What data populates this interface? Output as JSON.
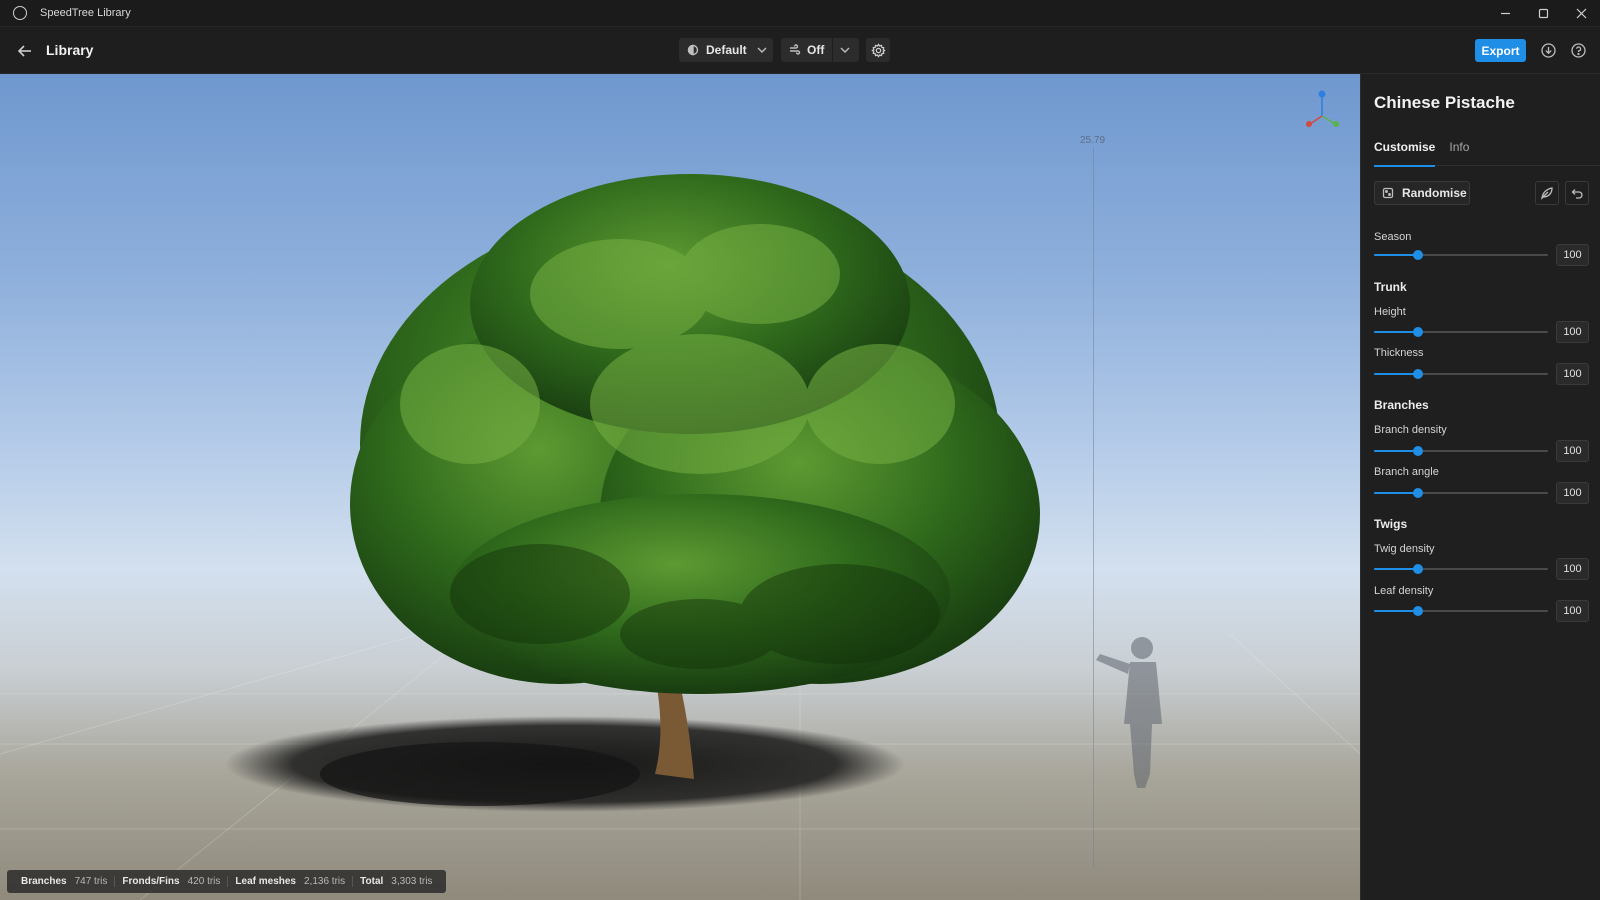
{
  "window": {
    "title": "SpeedTree Library"
  },
  "toolbar": {
    "page_title": "Library",
    "lighting_label": "Default",
    "wind_label": "Off",
    "export_label": "Export"
  },
  "viewport": {
    "height_readout": "25.79",
    "stats": [
      {
        "label": "Branches",
        "value": "747 tris"
      },
      {
        "label": "Fronds/Fins",
        "value": "420 tris"
      },
      {
        "label": "Leaf meshes",
        "value": "2,136 tris"
      },
      {
        "label": "Total",
        "value": "3,303 tris"
      }
    ]
  },
  "panel": {
    "species_title": "Chinese Pistache",
    "tabs": [
      {
        "label": "Customise"
      },
      {
        "label": "Info"
      }
    ],
    "randomise_label": "Randomise",
    "season": {
      "label": "Season",
      "value": "100",
      "level": 0.25
    },
    "sections": {
      "trunk": "Trunk",
      "branches": "Branches",
      "twigs": "Twigs"
    },
    "params": {
      "height": {
        "label": "Height",
        "value": "100",
        "level": 0.25
      },
      "thickness": {
        "label": "Thickness",
        "value": "100",
        "level": 0.25
      },
      "branch_density": {
        "label": "Branch density",
        "value": "100",
        "level": 0.25
      },
      "branch_angle": {
        "label": "Branch angle",
        "value": "100",
        "level": 0.25
      },
      "twig_density": {
        "label": "Twig density",
        "value": "100",
        "level": 0.25
      },
      "leaf_density": {
        "label": "Leaf density",
        "value": "100",
        "level": 0.25
      }
    }
  },
  "colors": {
    "accent": "#1e8ee6",
    "background": "#1c1c1c",
    "panel": "#1f1f1f"
  },
  "icons": {
    "app": "app-logo-icon",
    "back": "arrow-left-icon",
    "lighting": "sun-icon",
    "wind": "wind-icon",
    "settings": "gear-icon",
    "download": "download-icon",
    "help": "help-icon",
    "randomise": "dice-icon",
    "leaf": "leaf-icon",
    "undo": "undo-icon"
  }
}
